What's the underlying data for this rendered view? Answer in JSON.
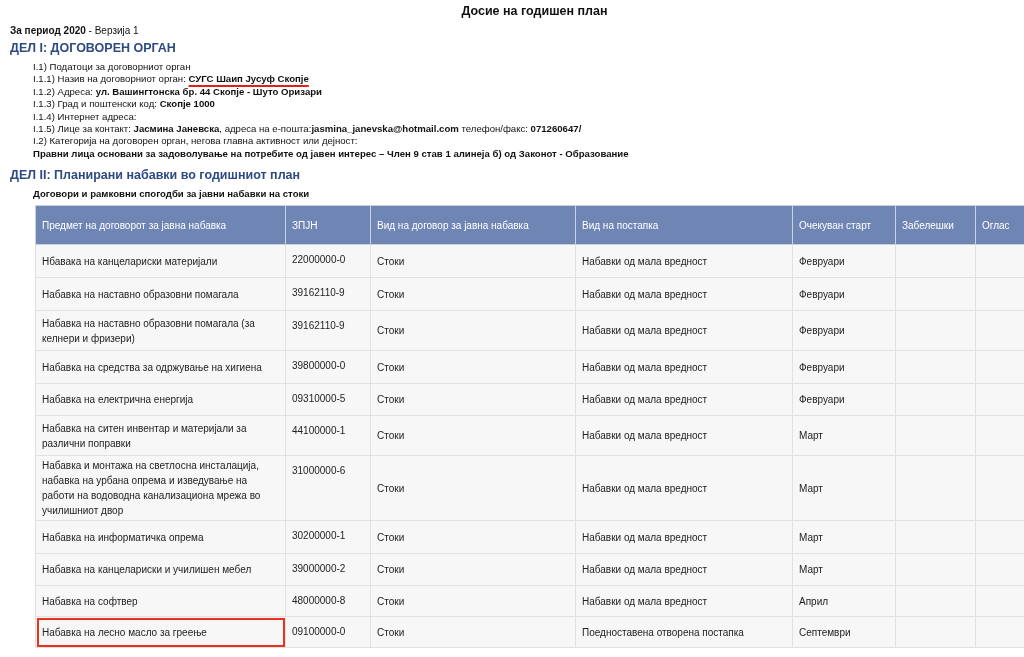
{
  "title": "Досие на годишен план",
  "period": "**За период 2020** - Верзија 1",
  "part1": {
    "heading": "ДЕЛ I: ДОГОВОРЕН ОРГАН",
    "lines": [
      {
        "text": "I.1) Податоци за договорниот орган",
        "underlined": false
      },
      {
        "text": "I.1.1) Назив на договорниот орган: ",
        "value": "СУГС Шаип Јусуф Скопје",
        "underlined": true
      },
      {
        "text": "I.1.2) Адреса: **ул. Вашингтонска бр. 44 Скопје - Шуто Оризари**",
        "underlined": false
      },
      {
        "text": "I.1.3) Град и поштенски код: **Скопје 1000**",
        "underlined": false
      },
      {
        "text": "I.1.4) Интернет адреса:",
        "underlined": false
      },
      {
        "text": "I.1.5) Лице за контакт: **Јасмина Јаневска**, адреса на е-пошта:**jasmina_janevska@hotmail.com** телефон/факс: **071260647/**",
        "underlined": false
      },
      {
        "text": "I.2) Категорија на договорен орган, негова главна активност или дејност:",
        "underlined": false
      },
      {
        "text": "**Правни лица основани за задоволување на потребите од јавен интерес – Член 9 став 1 алинеја б) од Законот - Образование**",
        "underlined": false
      }
    ]
  },
  "part2": {
    "heading": "ДЕЛ II: Планирани набавки во годишниот план",
    "subheading": "Договори и рамковни спогодби за јавни набавки на стоки",
    "table": {
      "columns": [
        "Предмет на договорот за јавна набавка",
        "ЗПЈН",
        "Вид на договор за јавна набавка",
        "Вид на постапка",
        "Очекуван старт",
        "Забелешки",
        "Оглас"
      ],
      "rows": [
        {
          "subject": "Нбавака на канцелариски материјали",
          "code": "22000000-0",
          "contract": "Стоки",
          "procedure": "Набавки од мала вредност",
          "start": "Февруари",
          "highlighted": false
        },
        {
          "subject": "Набавка на наставно образовни помагала",
          "code": "39162110-9",
          "contract": "Стоки",
          "procedure": "Набавки од мала вредност",
          "start": "Февруари",
          "highlighted": false
        },
        {
          "subject": "Набавка на наставно образовни помагала (за келнери и фризери)",
          "code": "39162110-9",
          "contract": "Стоки",
          "procedure": "Набавки од мала вредност",
          "start": "Февруари",
          "highlighted": false
        },
        {
          "subject": "Набавка на средства за одржување на хигиена",
          "code": "39800000-0",
          "contract": "Стоки",
          "procedure": "Набавки од мала вредност",
          "start": "Февруари",
          "highlighted": false
        },
        {
          "subject": "Набавка на електрична енергија",
          "code": "09310000-5",
          "contract": "Стоки",
          "procedure": "Набавки од мала вредност",
          "start": "Февруари",
          "highlighted": false
        },
        {
          "subject": "Набавка на ситен инвентар и материјали за различни поправки",
          "code": "44100000-1",
          "contract": "Стоки",
          "procedure": "Набавки од мала вредност",
          "start": "Март",
          "highlighted": false
        },
        {
          "subject": "Набавка и монтажа на светлосна инсталација, набавка на урбана опрема и изведување на работи на водоводна канализациона мрежа во училишниот двор",
          "code": "31000000-6",
          "contract": "Стоки",
          "procedure": "Набавки од мала вредност",
          "start": "Март",
          "highlighted": false
        },
        {
          "subject": "Набавка на информатичка опрема",
          "code": "30200000-1",
          "contract": "Стоки",
          "procedure": "Набавки од мала вредност",
          "start": "Март",
          "highlighted": false
        },
        {
          "subject": "Набавка на канцелариски и училишен мебел",
          "code": "39000000-2",
          "contract": "Стоки",
          "procedure": "Набавки од мала вредност",
          "start": "Март",
          "highlighted": false
        },
        {
          "subject": "Набавка на софтвер",
          "code": "48000000-8",
          "contract": "Стоки",
          "procedure": "Набавки од мала вредност",
          "start": "Април",
          "highlighted": false
        },
        {
          "subject": "Набавка на лесно масло за греење",
          "code": "09100000-0",
          "contract": "Стоки",
          "procedure": "Поедноставена отворена постапка",
          "start": "Септември",
          "highlighted": true
        }
      ]
    }
  }
}
